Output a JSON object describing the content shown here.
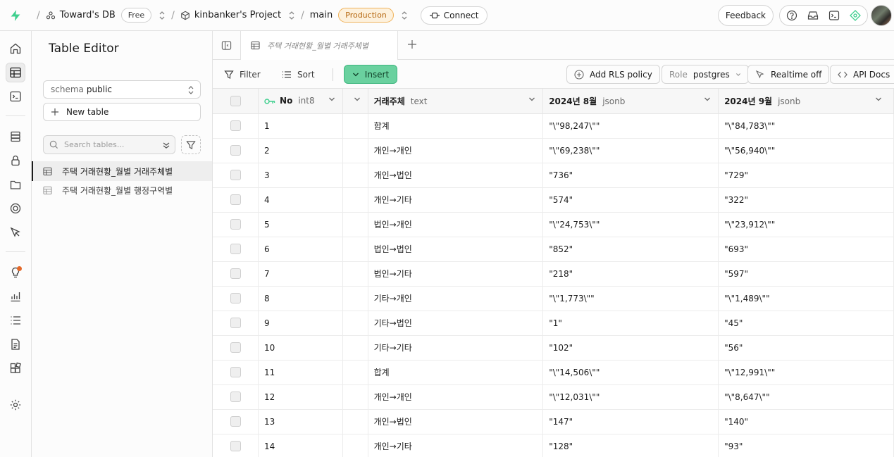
{
  "topbar": {
    "org": "Toward's DB",
    "org_plan": "Free",
    "project": "kinbanker's Project",
    "branch": "main",
    "branch_env": "Production",
    "connect_label": "Connect",
    "feedback_label": "Feedback"
  },
  "sidebar": {
    "title": "Table Editor",
    "schema_label": "schema",
    "schema_value": "public",
    "new_table_label": "New table",
    "search_placeholder": "Search tables...",
    "tables": [
      {
        "label": "주택 거래현황_월별 거래주체별"
      },
      {
        "label": "주택 거래현황_월별 행정구역별"
      }
    ]
  },
  "tabs": {
    "active_label": "주택 거래현황_월별 거래주체별"
  },
  "toolbar": {
    "filter_label": "Filter",
    "sort_label": "Sort",
    "insert_label": "Insert",
    "rls_label": "Add RLS policy",
    "role_prefix": "Role",
    "role_value": "postgres",
    "realtime_label": "Realtime off",
    "api_docs_label": "API Docs"
  },
  "grid": {
    "columns": [
      {
        "name": "No",
        "type": "int8"
      },
      {
        "name": "거래주체",
        "type": "text"
      },
      {
        "name": "2024년 8월",
        "type": "jsonb"
      },
      {
        "name": "2024년 9월",
        "type": "jsonb"
      }
    ],
    "rows": [
      {
        "no": "1",
        "subject": "합계",
        "aug": "\"\\\"98,247\\\"\"",
        "sep": "\"\\\"84,783\\\"\""
      },
      {
        "no": "2",
        "subject": "개인→개인",
        "aug": "\"\\\"69,238\\\"\"",
        "sep": "\"\\\"56,940\\\"\""
      },
      {
        "no": "3",
        "subject": "개인→법인",
        "aug": "\"736\"",
        "sep": "\"729\""
      },
      {
        "no": "4",
        "subject": "개인→기타",
        "aug": "\"574\"",
        "sep": "\"322\""
      },
      {
        "no": "5",
        "subject": "법인→개인",
        "aug": "\"\\\"24,753\\\"\"",
        "sep": "\"\\\"23,912\\\"\""
      },
      {
        "no": "6",
        "subject": "법인→법인",
        "aug": "\"852\"",
        "sep": "\"693\""
      },
      {
        "no": "7",
        "subject": "법인→기타",
        "aug": "\"218\"",
        "sep": "\"597\""
      },
      {
        "no": "8",
        "subject": "기타→개인",
        "aug": "\"\\\"1,773\\\"\"",
        "sep": "\"\\\"1,489\\\"\""
      },
      {
        "no": "9",
        "subject": "기타→법인",
        "aug": "\"1\"",
        "sep": "\"45\""
      },
      {
        "no": "10",
        "subject": "기타→기타",
        "aug": "\"102\"",
        "sep": "\"56\""
      },
      {
        "no": "11",
        "subject": "합계",
        "aug": "\"\\\"14,506\\\"\"",
        "sep": "\"\\\"12,991\\\"\""
      },
      {
        "no": "12",
        "subject": "개인→개인",
        "aug": "\"\\\"12,031\\\"\"",
        "sep": "\"\\\"8,647\\\"\""
      },
      {
        "no": "13",
        "subject": "개인→법인",
        "aug": "\"147\"",
        "sep": "\"140\""
      },
      {
        "no": "14",
        "subject": "개인→기타",
        "aug": "\"128\"",
        "sep": "\"93\""
      }
    ]
  },
  "colors": {
    "brand": "#3ecf8e",
    "insert": "#6ad19f",
    "production_badge": "#fdf1dd",
    "notification": "#e4692a"
  }
}
